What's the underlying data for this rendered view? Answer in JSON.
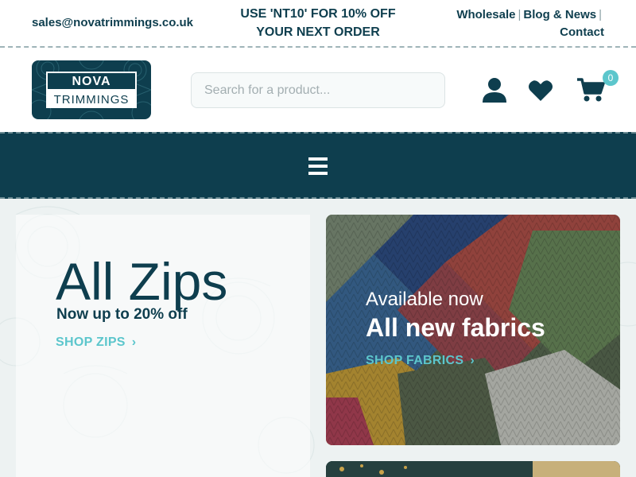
{
  "topbar": {
    "email": "sales@novatrimmings.co.uk",
    "promo_line1": "USE 'NT10' FOR 10% OFF",
    "promo_line2": "YOUR NEXT ORDER",
    "links": [
      "Wholesale",
      "Blog & News",
      "Contact"
    ],
    "separator": "|"
  },
  "logo": {
    "line1": "NOVA",
    "line2": "TRIMMINGS"
  },
  "search": {
    "placeholder": "Search for a product..."
  },
  "header_icons": [
    "user-icon",
    "heart-icon",
    "cart-icon"
  ],
  "cart": {
    "count": "0"
  },
  "nav": {
    "menu_icon": "hamburger-icon"
  },
  "promo_left": {
    "title": "All Zips",
    "subtitle": "Now up to 20% off",
    "link": "SHOP ZIPS"
  },
  "promo_right": {
    "pretitle": "Available now",
    "title": "All new fabrics",
    "link": "SHOP FABRICS"
  },
  "colors": {
    "brand_dark": "#0e3e4e",
    "accent": "#5cc6cc"
  }
}
